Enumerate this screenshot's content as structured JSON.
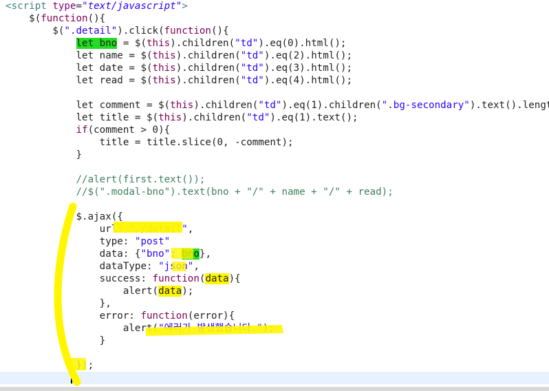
{
  "editor": {
    "lines": [
      [
        [
          "tag",
          "<script "
        ],
        [
          "attr",
          "type"
        ],
        [
          "",
          "="
        ],
        [
          "attrval",
          "\"text/javascript\""
        ],
        [
          "tag",
          ">"
        ]
      ],
      [
        [
          "",
          "    $("
        ],
        [
          "kw",
          "function"
        ],
        [
          "",
          "(){"
        ]
      ],
      [
        [
          "",
          "        $("
        ],
        [
          "str",
          "\".detail\""
        ],
        [
          "",
          ").click("
        ],
        [
          "kw",
          "function"
        ],
        [
          "",
          "(){"
        ]
      ],
      [
        [
          "",
          "            "
        ],
        [
          "hl-green",
          "let bno"
        ],
        [
          "",
          " = $("
        ],
        [
          "kw",
          "this"
        ],
        [
          "",
          ").children("
        ],
        [
          "str",
          "\"td\""
        ],
        [
          "",
          ").eq(0).html();"
        ]
      ],
      [
        [
          "",
          "            let name = $("
        ],
        [
          "kw",
          "this"
        ],
        [
          "",
          ").children("
        ],
        [
          "str",
          "\"td\""
        ],
        [
          "",
          ").eq(2).html();"
        ]
      ],
      [
        [
          "",
          "            let date = $("
        ],
        [
          "kw",
          "this"
        ],
        [
          "",
          ").children("
        ],
        [
          "str",
          "\"td\""
        ],
        [
          "",
          ").eq(3).html();"
        ]
      ],
      [
        [
          "",
          "            let read = $("
        ],
        [
          "kw",
          "this"
        ],
        [
          "",
          ").children("
        ],
        [
          "str",
          "\"td\""
        ],
        [
          "",
          ").eq(4).html();"
        ]
      ],
      [
        [
          "",
          ""
        ]
      ],
      [
        [
          "",
          "            let comment = $("
        ],
        [
          "kw",
          "this"
        ],
        [
          "",
          ").children("
        ],
        [
          "str",
          "\"td\""
        ],
        [
          "",
          ").eq(1).children("
        ],
        [
          "str",
          "\".bg-secondary\""
        ],
        [
          "",
          ").text().length;"
        ]
      ],
      [
        [
          "",
          "            let title = $("
        ],
        [
          "kw",
          "this"
        ],
        [
          "",
          ").children("
        ],
        [
          "str",
          "\"td\""
        ],
        [
          "",
          ").eq(1).text();"
        ]
      ],
      [
        [
          "",
          "            "
        ],
        [
          "kw",
          "if"
        ],
        [
          "",
          "(comment > 0){"
        ]
      ],
      [
        [
          "",
          "                title = title.slice(0, -comment);"
        ]
      ],
      [
        [
          "",
          "            }"
        ]
      ],
      [
        [
          "",
          ""
        ]
      ],
      [
        [
          "",
          "            "
        ],
        [
          "cmt",
          "//alert(first.text());"
        ]
      ],
      [
        [
          "",
          "            "
        ],
        [
          "cmt",
          "//$(\".modal-bno\").text(bno + \"/\" + name + \"/\" + read);"
        ]
      ],
      [
        [
          "",
          ""
        ]
      ],
      [
        [
          "",
          "            $.ajax({"
        ]
      ],
      [
        [
          "",
          "                url: "
        ],
        [
          "str",
          "\"./detail\""
        ],
        [
          "",
          ","
        ]
      ],
      [
        [
          "",
          "                type: "
        ],
        [
          "str",
          "\"post\""
        ]
      ],
      [
        [
          "",
          "                data: {"
        ],
        [
          "str",
          "\"bno\""
        ],
        [
          "",
          ": "
        ],
        [
          "hl-green",
          "bno"
        ],
        [
          "",
          "},"
        ]
      ],
      [
        [
          "",
          "                dataType: "
        ],
        [
          "str",
          "\"json\""
        ],
        [
          "",
          ","
        ]
      ],
      [
        [
          "",
          "                success: "
        ],
        [
          "kw",
          "function"
        ],
        [
          "",
          "("
        ],
        [
          "hl-yellow",
          "data"
        ],
        [
          "",
          "){"
        ]
      ],
      [
        [
          "",
          "                    alert("
        ],
        [
          "hl-yellow",
          "data"
        ],
        [
          "",
          ");"
        ]
      ],
      [
        [
          "",
          "                },"
        ]
      ],
      [
        [
          "",
          "                error: "
        ],
        [
          "kw",
          "function"
        ],
        [
          "",
          "(error){"
        ]
      ],
      [
        [
          "",
          "                    alert("
        ],
        [
          "str",
          "\"에러가 발생했습니다.\""
        ],
        [
          "",
          ");"
        ]
      ],
      [
        [
          "",
          "                }"
        ]
      ],
      [
        [
          "",
          ""
        ]
      ],
      [
        [
          "",
          "            });"
        ]
      ],
      [
        [
          "",
          ""
        ]
      ]
    ]
  }
}
